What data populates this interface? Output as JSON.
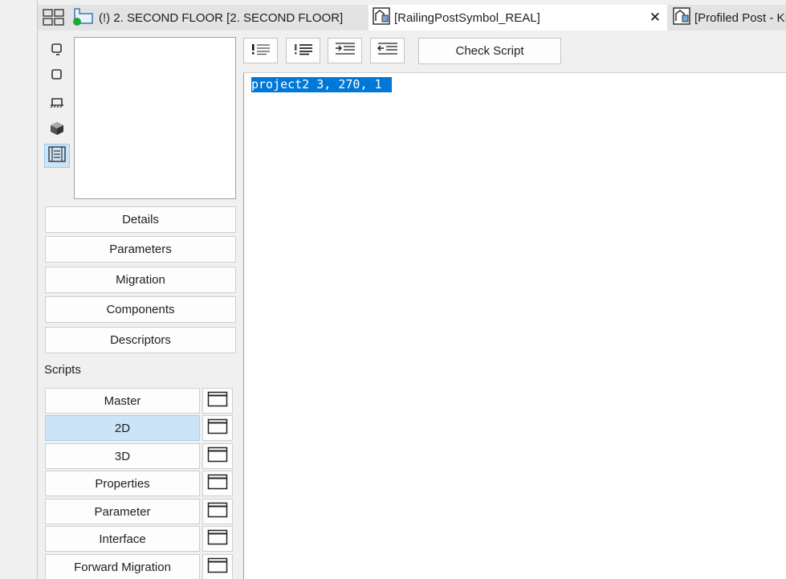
{
  "tabs": [
    {
      "label": "(!) 2. SECOND FLOOR [2. SECOND FLOOR]",
      "icon": "floor-plan-icon"
    },
    {
      "label": "[RailingPostSymbol_REAL]",
      "icon": "library-part-icon",
      "active": true,
      "close": "✕"
    },
    {
      "label": "[Profiled Post - KI",
      "icon": "library-part-icon"
    }
  ],
  "left_panel": {
    "view_buttons": [
      "2d-symbol-icon",
      "3d-box-icon",
      "floor-plan-view-icon",
      "3d-solid-icon",
      "film-strip-icon"
    ],
    "main_buttons": [
      "Details",
      "Parameters",
      "Migration",
      "Components",
      "Descriptors"
    ],
    "scripts_label": "Scripts",
    "script_buttons": [
      "Master",
      "2D",
      "3D",
      "Properties",
      "Parameter",
      "Interface",
      "Forward Migration"
    ],
    "active_script": "2D"
  },
  "toolbar": {
    "check_script_label": "Check Script"
  },
  "editor": {
    "code": "project2 3, 270, 1"
  },
  "colors": {
    "selection": "#0078d7",
    "active_button": "#cce4f7"
  }
}
